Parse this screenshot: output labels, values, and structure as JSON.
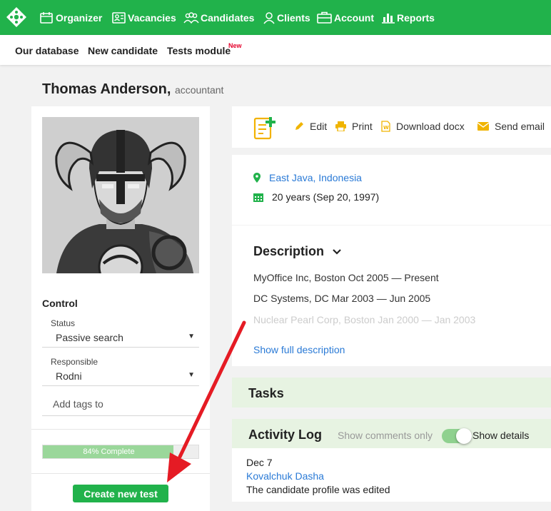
{
  "nav": {
    "items": [
      {
        "label": "Organizer",
        "icon": "organizer-icon"
      },
      {
        "label": "Vacancies",
        "icon": "vacancies-icon"
      },
      {
        "label": "Candidates",
        "icon": "candidates-icon"
      },
      {
        "label": "Clients",
        "icon": "clients-icon"
      },
      {
        "label": "Account",
        "icon": "account-icon"
      },
      {
        "label": "Reports",
        "icon": "reports-icon"
      }
    ],
    "bg_color": "#21b24b"
  },
  "subnav": {
    "items": [
      "Our database",
      "New candidate",
      "Tests module"
    ],
    "badge": "New"
  },
  "candidate": {
    "name": "Thomas Anderson,",
    "position": "accountant"
  },
  "control": {
    "heading": "Control",
    "status_label": "Status",
    "status_value": "Passive search",
    "responsible_label": "Responsible",
    "responsible_value": "Rodni",
    "tags_placeholder": "Add tags to",
    "progress_text": "84% Complete",
    "progress_value": 0.84,
    "create_test_label": "Create new test"
  },
  "toolbar": {
    "edit": "Edit",
    "print": "Print",
    "download": "Download docx",
    "send": "Send email"
  },
  "info": {
    "location": "East Java, Indonesia",
    "age": "20 years (Sep 20, 1997)"
  },
  "description": {
    "heading": "Description",
    "lines": [
      "MyOffice Inc, Boston Oct 2005 — Present",
      "DC Systems, DC Mar 2003 — Jun 2005"
    ],
    "faded": "Nuclear Pearl Corp, Boston Jan 2000 — Jan 2003",
    "show_full": "Show full description"
  },
  "tasks": {
    "heading": "Tasks"
  },
  "activity": {
    "heading": "Activity Log",
    "toggle_off_label": "Show comments only",
    "toggle_on_label": "Show details",
    "entry": {
      "date": "Dec 7",
      "user": "Kovalchuk Dasha",
      "text": "The candidate profile was edited"
    }
  }
}
